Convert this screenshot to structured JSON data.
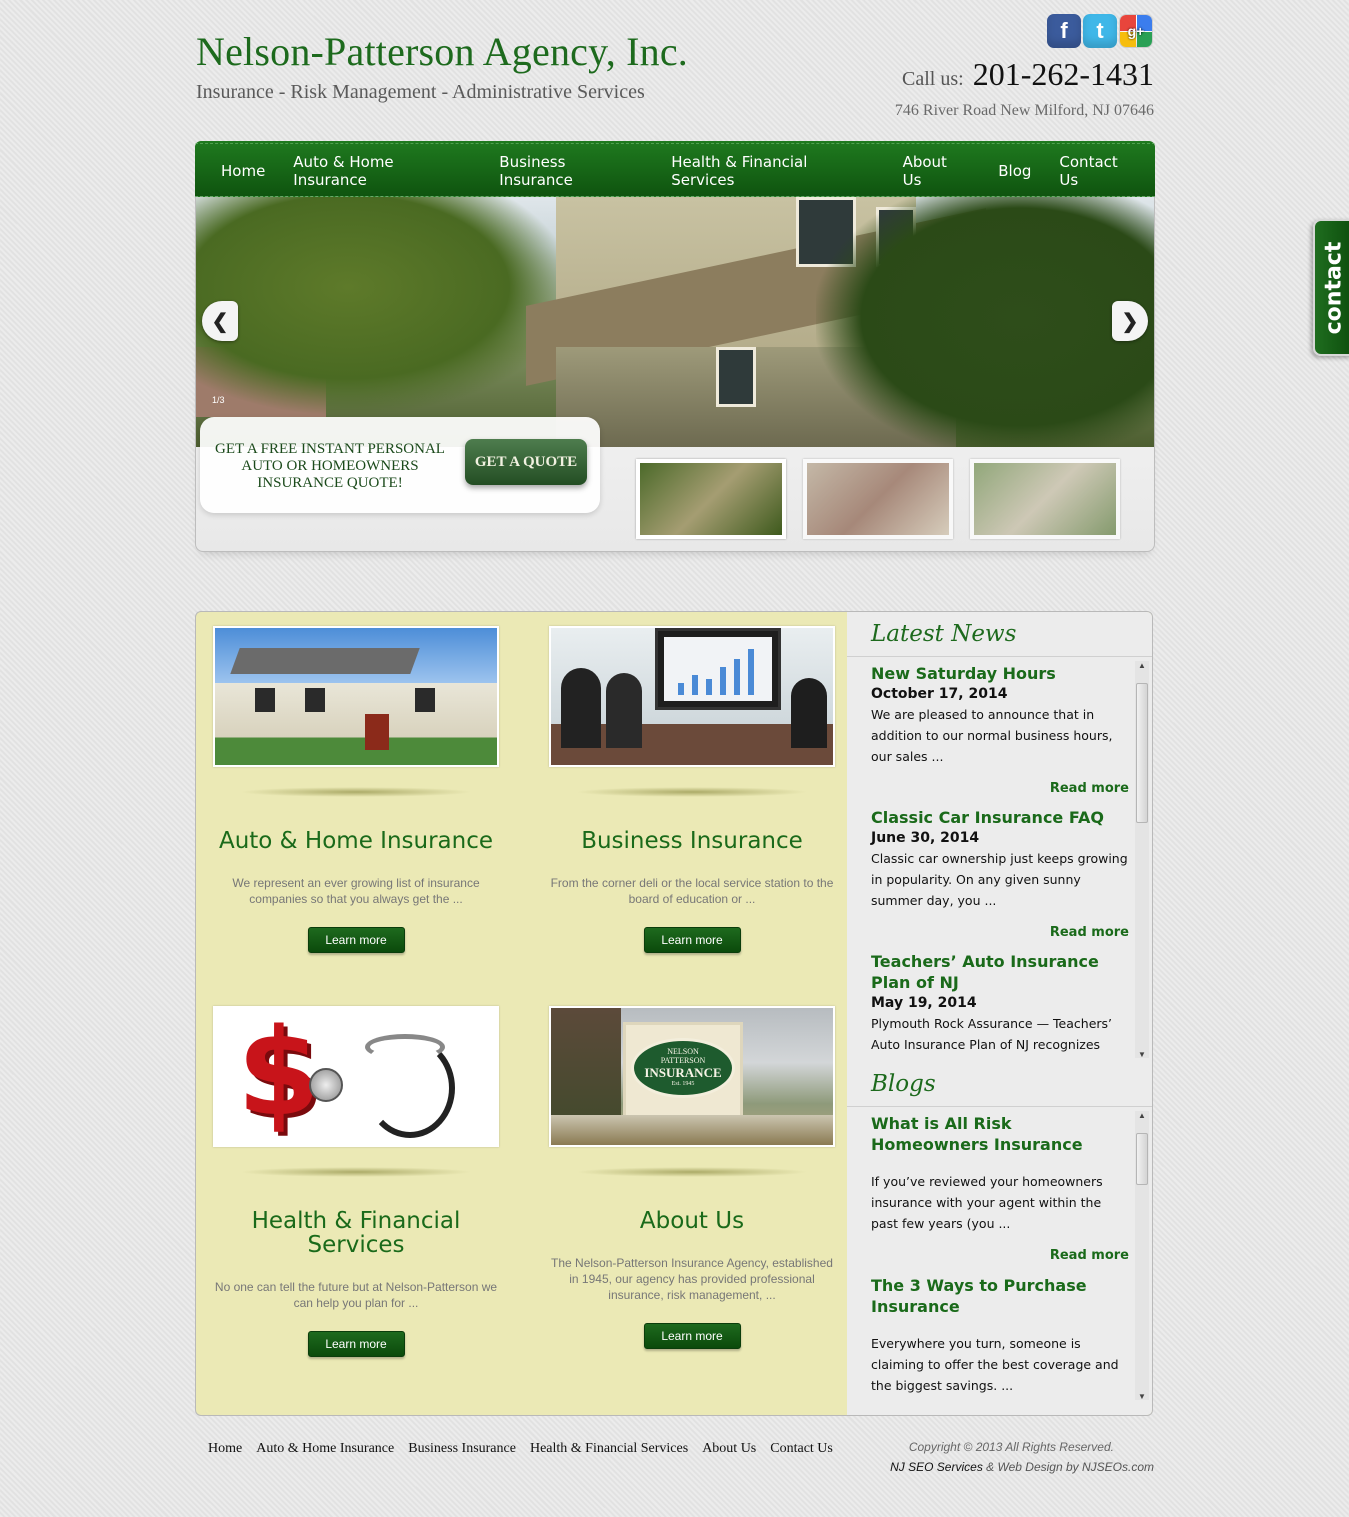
{
  "header": {
    "title": "Nelson-Patterson Agency, Inc.",
    "tagline": "Insurance - Risk Management - Administrative Services",
    "call_label": "Call us:",
    "phone": "201-262-1431",
    "address": "746 River Road New Milford, NJ 07646",
    "social": [
      "f",
      "t",
      "g+"
    ]
  },
  "nav": {
    "items": [
      "Home",
      "Auto & Home Insurance",
      "Business Insurance",
      "Health & Financial Services",
      "About Us",
      "Blog",
      "Contact Us"
    ]
  },
  "slider": {
    "counter": "1/3",
    "prev_icon": "chevron-left-icon",
    "next_icon": "chevron-right-icon",
    "quote_text": "GET A FREE INSTANT PERSONAL AUTO OR HOMEOWNERS INSURANCE QUOTE!",
    "quote_button": "GET A QUOTE"
  },
  "contact_tab": "contact",
  "tiles": [
    {
      "title": "Auto & Home Insurance",
      "text": "We represent an ever growing list of insurance companies so that you always get the ...",
      "button": "Learn more"
    },
    {
      "title": "Business Insurance",
      "text": "From the corner deli or the local service station to the board of education or ...",
      "button": "Learn more"
    },
    {
      "title": "Health & Financial Services",
      "text": "No one can tell the future but at Nelson-Patterson we can help you plan for ...",
      "button": "Learn more"
    },
    {
      "title": "About Us",
      "text": "The Nelson-Patterson Insurance Agency, established in 1945, our agency has provided professional insurance, risk management, ...",
      "button": "Learn more"
    }
  ],
  "sign": {
    "line1": "NELSON",
    "line2": "PATTERSON",
    "line3": "INSURANCE",
    "line4": "Est. 1945"
  },
  "latest_news": {
    "heading": "Latest News",
    "items": [
      {
        "title": "New Saturday Hours",
        "date": "October 17, 2014",
        "body": "We are pleased to announce that in addition to our normal business hours, our sales ...",
        "read_more": "Read more"
      },
      {
        "title": "Classic Car Insurance FAQ",
        "date": "June 30, 2014",
        "body": "Classic car ownership just keeps growing in popularity.  On any given sunny summer day, you ...",
        "read_more": "Read more"
      },
      {
        "title": "Teachers’ Auto Insurance Plan of NJ",
        "date": "May 19, 2014",
        "body": "Plymouth Rock Assurance — Teachers’ Auto Insurance Plan of NJ recognizes"
      }
    ]
  },
  "blogs": {
    "heading": "Blogs",
    "items": [
      {
        "title": "What is All Risk Homeowners Insurance",
        "body": "If you’ve reviewed your homeowners insurance with your agent within the past few years (you ...",
        "read_more": "Read more"
      },
      {
        "title": "The 3 Ways to Purchase Insurance",
        "body": "Everywhere you turn, someone is claiming to offer the best coverage and the biggest savings.  ..."
      }
    ]
  },
  "footer": {
    "nav": [
      "Home",
      "Auto & Home Insurance",
      "Business Insurance",
      "Health & Financial Services",
      "About Us",
      "Contact Us"
    ],
    "copyright": "Copyright © 2013 All Rights Reserved.",
    "credit_link": "NJ SEO Services",
    "credit_rest": " & Web Design by NJSEOs.com"
  }
}
